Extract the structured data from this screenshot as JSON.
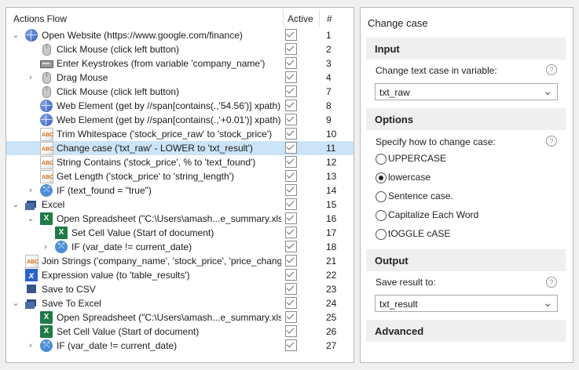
{
  "flow": {
    "header": {
      "title": "Actions Flow",
      "active": "Active",
      "number": "#"
    },
    "rows": [
      {
        "toggle": "open",
        "icon": "globe",
        "indent": 0,
        "label": "Open Website (https://www.google.com/finance)",
        "num": "1"
      },
      {
        "toggle": "",
        "icon": "mouse",
        "indent": 1,
        "label": "Click Mouse (click left button)",
        "num": "2"
      },
      {
        "toggle": "",
        "icon": "keyboard",
        "indent": 1,
        "label": "Enter Keystrokes (from variable 'company_name')",
        "num": "3"
      },
      {
        "toggle": "closed",
        "icon": "mouse",
        "indent": 1,
        "label": "Drag Mouse",
        "num": "4"
      },
      {
        "toggle": "",
        "icon": "mouse",
        "indent": 1,
        "label": "Click Mouse (click left button)",
        "num": "7"
      },
      {
        "toggle": "",
        "icon": "globe",
        "indent": 1,
        "label": "Web Element (get by //span[contains(.,'54.56')] xpath)",
        "num": "8"
      },
      {
        "toggle": "",
        "icon": "globe",
        "indent": 1,
        "label": "Web Element (get by //span[contains(.,'+0.01')] xpath)",
        "num": "9"
      },
      {
        "toggle": "",
        "icon": "abc",
        "indent": 1,
        "label": "Trim Whitespace ('stock_price_raw' to 'stock_price')",
        "num": "10"
      },
      {
        "toggle": "",
        "icon": "abc",
        "indent": 1,
        "label": "Change case ('txt_raw' - LOWER to 'txt_result')",
        "num": "11",
        "selected": true
      },
      {
        "toggle": "",
        "icon": "abc",
        "indent": 1,
        "label": "String Contains ('stock_price', % to 'text_found')",
        "num": "12"
      },
      {
        "toggle": "",
        "icon": "abc",
        "indent": 1,
        "label": "Get Length ('stock_price' to 'string_length')",
        "num": "13"
      },
      {
        "toggle": "closed",
        "icon": "if",
        "indent": 1,
        "label": "IF (text_found = \"true\")",
        "num": "14"
      },
      {
        "toggle": "open",
        "icon": "excel-group",
        "indent": 0,
        "label": "Excel",
        "num": "15"
      },
      {
        "toggle": "open",
        "icon": "excel",
        "indent": 1,
        "label": "Open Spreadsheet (\"C:\\Users\\amash...e_summary.xlsx\"",
        "num": "16"
      },
      {
        "toggle": "",
        "icon": "excel",
        "indent": 2,
        "label": "Set Cell Value (Start of document)",
        "num": "17"
      },
      {
        "toggle": "closed",
        "icon": "if",
        "indent": 2,
        "label": "IF (var_date != current_date)",
        "num": "18"
      },
      {
        "toggle": "",
        "icon": "abc",
        "indent": 0,
        "label": "Join Strings ('company_name', 'stock_price', 'price_change",
        "num": "21"
      },
      {
        "toggle": "",
        "icon": "expression",
        "indent": 0,
        "label": "Expression value (to 'table_results')",
        "num": "22"
      },
      {
        "toggle": "",
        "icon": "csv",
        "indent": 0,
        "label": "Save to CSV",
        "num": "23"
      },
      {
        "toggle": "open",
        "icon": "excel-group",
        "indent": 0,
        "label": "Save To Excel",
        "num": "24"
      },
      {
        "toggle": "",
        "icon": "excel",
        "indent": 1,
        "label": "Open Spreadsheet (\"C:\\Users\\amash...e_summary.xlsx\"",
        "num": "25"
      },
      {
        "toggle": "",
        "icon": "excel",
        "indent": 1,
        "label": "Set Cell Value (Start of document)",
        "num": "26"
      },
      {
        "toggle": "closed",
        "icon": "if",
        "indent": 1,
        "label": "IF (var_date != current_date)",
        "num": "27"
      }
    ]
  },
  "props": {
    "title": "Change case",
    "input": {
      "heading": "Input",
      "label": "Change text case in variable:",
      "value": "txt_raw"
    },
    "options": {
      "heading": "Options",
      "label": "Specify how to change case:",
      "choices": [
        "UPPERCASE",
        "lowercase",
        "Sentence case.",
        "Capitalize Each Word",
        "tOGGLE cASE"
      ],
      "selected": "lowercase"
    },
    "output": {
      "heading": "Output",
      "label": "Save result to:",
      "value": "txt_result"
    },
    "advanced": {
      "heading": "Advanced"
    }
  }
}
